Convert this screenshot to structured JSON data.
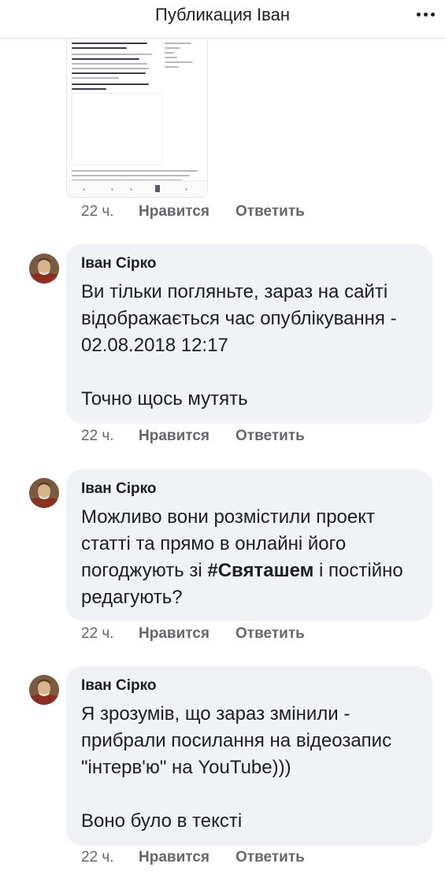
{
  "header": {
    "title": "Публикация Іван"
  },
  "attachment_meta": {
    "time": "22 ч.",
    "like_label": "Нравится",
    "reply_label": "Ответить"
  },
  "comments": [
    {
      "author": "Іван Сірко",
      "paragraphs": [
        "Ви тільки погляньте, зараз на сайті відображається час опублікування - 02.08.2018 12:17",
        "Точно щось мутять"
      ],
      "time": "22 ч.",
      "like_label": "Нравится",
      "reply_label": "Ответить"
    },
    {
      "author": "Іван Сірко",
      "text_before": "Можливо вони розмістили проект статті та прямо в онлайні його погоджують зі ",
      "hashtag": "#Святашем",
      "text_after": " і постійно редагують?",
      "time": "22 ч.",
      "like_label": "Нравится",
      "reply_label": "Ответить"
    },
    {
      "author": "Іван Сірко",
      "paragraphs": [
        "Я зрозумів, що зараз змінили - прибрали посилання на відеозапис \"інтерв'ю\" на YouTube)))",
        "Воно було в тексті"
      ],
      "time": "22 ч.",
      "like_label": "Нравится",
      "reply_label": "Ответить"
    }
  ],
  "icons": {
    "more": "more-horizontal-icon",
    "avatar": "avatar-portrait"
  }
}
